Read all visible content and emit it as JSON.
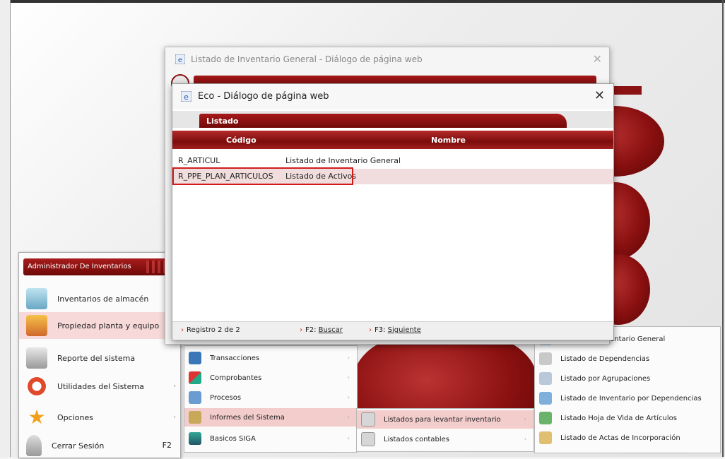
{
  "start_menu": {
    "header": "Administrador De Inventarios",
    "items": [
      {
        "label": "Inventarios de almacén",
        "icon": "warehouse-icon",
        "arrow": ""
      },
      {
        "label": "Propiedad planta y equipo",
        "icon": "house-icon",
        "arrow": "›"
      },
      {
        "label": "Reporte del sistema",
        "icon": "printer-icon",
        "arrow": ""
      },
      {
        "label": "Utilidades del Sistema",
        "icon": "lifebuoy-icon",
        "arrow": "›"
      },
      {
        "label": "Opciones",
        "icon": "star-icon",
        "arrow": "›"
      },
      {
        "label": "Cerrar Sesión",
        "icon": "key-icon",
        "arrow": "",
        "shortcut": "F2"
      }
    ]
  },
  "submenu_1": [
    {
      "label": "Transacciones",
      "icon": "transactions-icon"
    },
    {
      "label": "Comprobantes",
      "icon": "vouchers-icon"
    },
    {
      "label": "Procesos",
      "icon": "processes-icon"
    },
    {
      "label": "Informes del Sistema",
      "icon": "reports-icon"
    },
    {
      "label": "Basicos SIGA",
      "icon": "basics-icon"
    }
  ],
  "submenu_2": [
    {
      "label": "Listados para levantar inventario",
      "icon": "list-icon"
    },
    {
      "label": "Listados contables",
      "icon": "list-icon"
    }
  ],
  "submenu_3": [
    {
      "label": "Listado de Inventario General",
      "icon": "list-icon"
    },
    {
      "label": "Listado de Dependencias",
      "icon": "list-icon"
    },
    {
      "label": "Listado por Agrupaciones",
      "icon": "list-icon"
    },
    {
      "label": "Listado de Inventario por Dependencias",
      "icon": "list-icon"
    },
    {
      "label": "Listado Hoja de Vida de Artículos",
      "icon": "list-icon"
    },
    {
      "label": "Listado de Actas de Incorporación",
      "icon": "list-icon"
    }
  ],
  "back_dialog": {
    "title": "Listado de Inventario General - Diálogo de página web",
    "close": "✕"
  },
  "dialog": {
    "title": "Eco - Diálogo de página web",
    "close": "✕",
    "tab": "Listado",
    "columns": {
      "code": "Código",
      "name": "Nombre"
    },
    "rows": [
      {
        "code": "R_ARTICUL",
        "name": "Listado de Inventario General"
      },
      {
        "code": "R_PPE_PLAN_ARTICULOS",
        "name": "Listado de Activos"
      }
    ],
    "status": {
      "record": "Registro 2 de 2",
      "search_key": "F2:",
      "search": "Buscar",
      "next_key": "F3:",
      "next": "Siguiente"
    }
  },
  "colors": {
    "brand_red": "#8b1212",
    "highlight": "#d21c1c"
  }
}
